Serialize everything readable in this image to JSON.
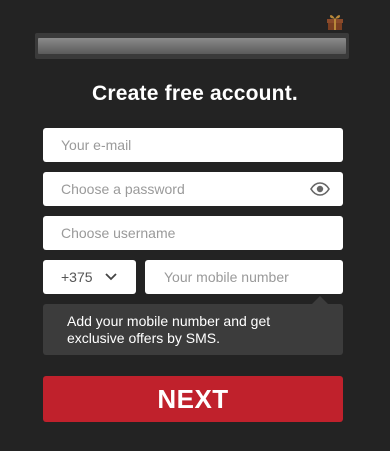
{
  "header": {
    "icons": {
      "gift": "gift-icon"
    }
  },
  "form": {
    "title": "Create free account.",
    "email": {
      "value": "",
      "placeholder": "Your e-mail"
    },
    "password": {
      "value": "",
      "placeholder": "Choose a password",
      "toggle_icon": "eye-icon"
    },
    "username": {
      "value": "",
      "placeholder": "Choose username"
    },
    "phone": {
      "country_code": "+375",
      "country_icon": "chevron-down-icon",
      "number": {
        "value": "",
        "placeholder": "Your mobile number"
      }
    },
    "tooltip": "Add your mobile number and get exclusive offers by SMS.",
    "next_label": "NEXT"
  },
  "colors": {
    "background": "#232323",
    "button": "#c0212c",
    "tooltip": "#3c3c3c",
    "gift": "#8a4a2a"
  }
}
